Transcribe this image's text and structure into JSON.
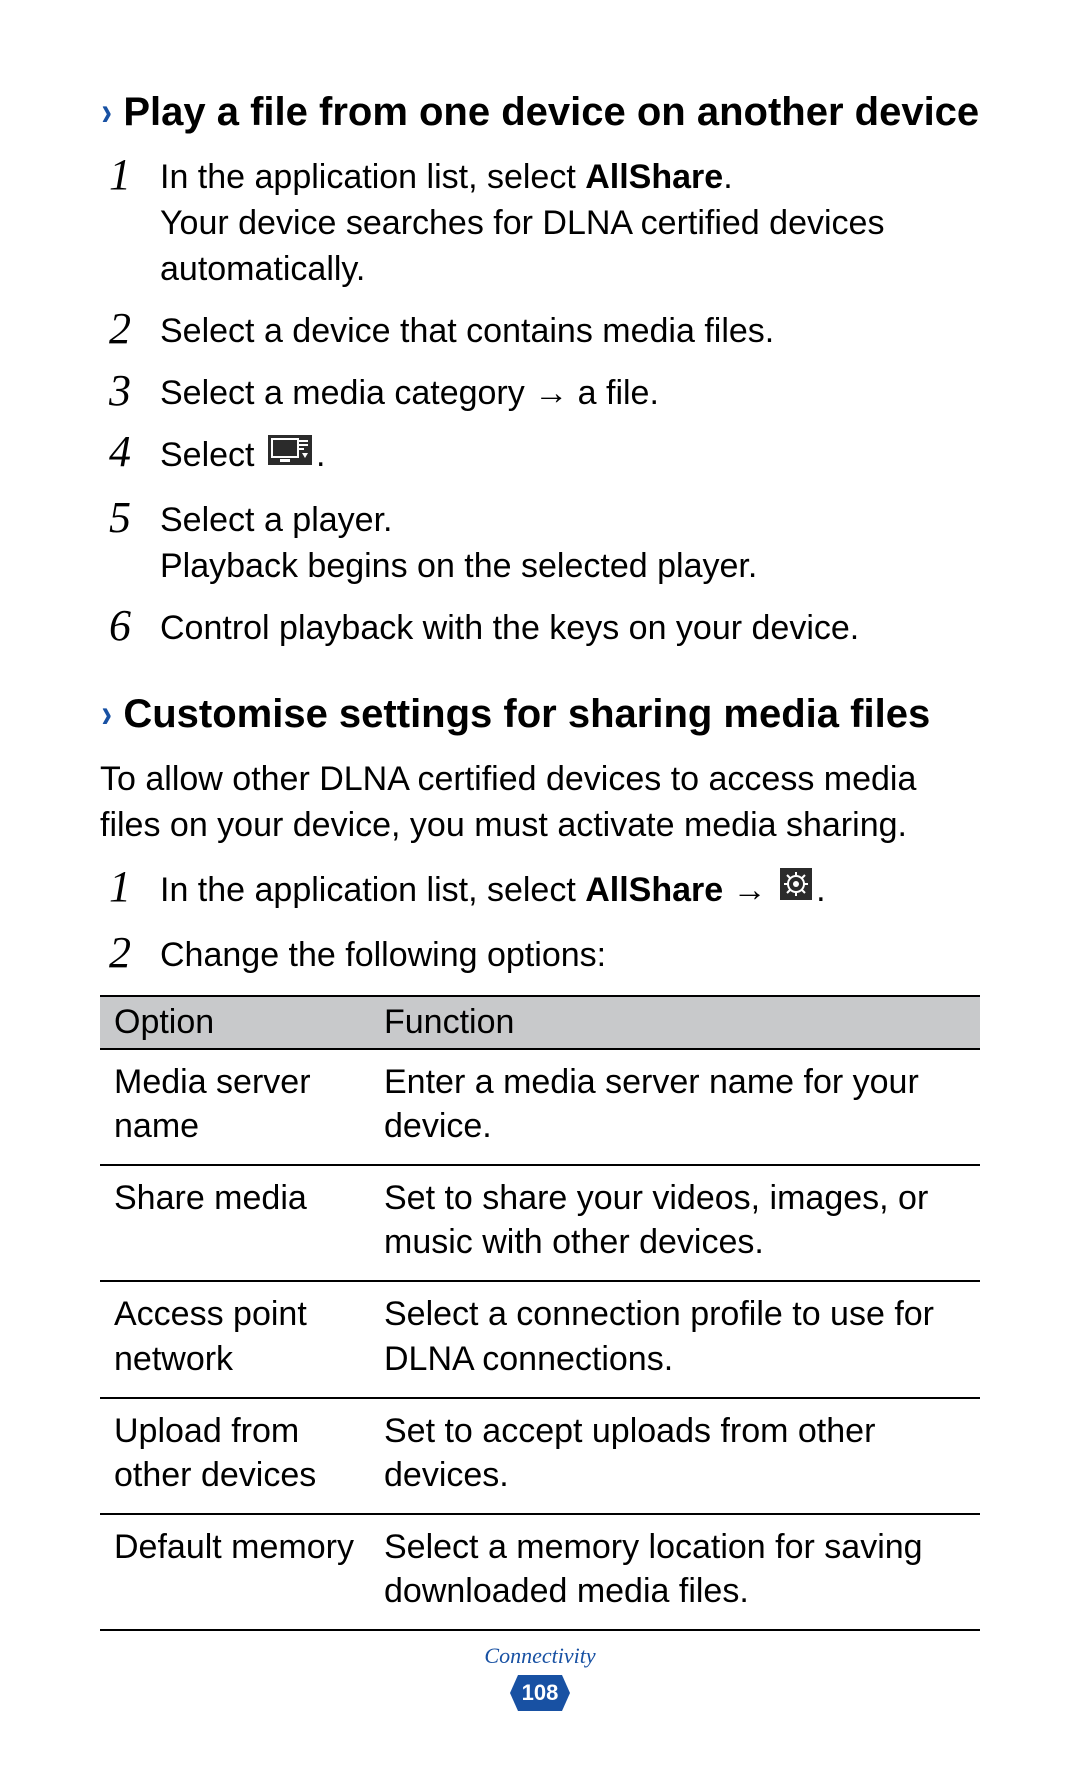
{
  "section1": {
    "heading": "Play a file from one device on another device",
    "steps": [
      {
        "num": "1",
        "pre": "In the application list, select ",
        "bold": "AllShare",
        "post": ".",
        "sub": "Your device searches for DLNA certified devices automatically."
      },
      {
        "num": "2",
        "text": "Select a device that contains media files."
      },
      {
        "num": "3",
        "text": "Select a media category → a file."
      },
      {
        "num": "4",
        "pre": "Select ",
        "icon": "cast-to-device-icon",
        "post": "."
      },
      {
        "num": "5",
        "text": "Select a player.",
        "sub": "Playback begins on the selected player."
      },
      {
        "num": "6",
        "text": "Control playback with the keys on your device."
      }
    ]
  },
  "section2": {
    "heading": "Customise settings for sharing media files",
    "intro": "To allow other DLNA certified devices to access media files on your device, you must activate media sharing.",
    "steps": [
      {
        "num": "1",
        "pre": "In the application list, select ",
        "bold": "AllShare",
        "post1": " → ",
        "icon": "settings-gear-icon",
        "post2": "."
      },
      {
        "num": "2",
        "text": "Change the following options:"
      }
    ]
  },
  "table": {
    "head": {
      "option": "Option",
      "function": "Function"
    },
    "rows": [
      {
        "option": "Media server name",
        "function": "Enter a media server name for your device."
      },
      {
        "option": "Share media",
        "function": "Set to share your videos, images, or music with other devices."
      },
      {
        "option": "Access point network",
        "function": "Select a connection profile to use for DLNA connections."
      },
      {
        "option": "Upload from other devices",
        "function": "Set to accept uploads from other devices."
      },
      {
        "option": "Default memory",
        "function": "Select a memory location for saving downloaded media files."
      }
    ]
  },
  "footer": {
    "section": "Connectivity",
    "page": "108"
  }
}
